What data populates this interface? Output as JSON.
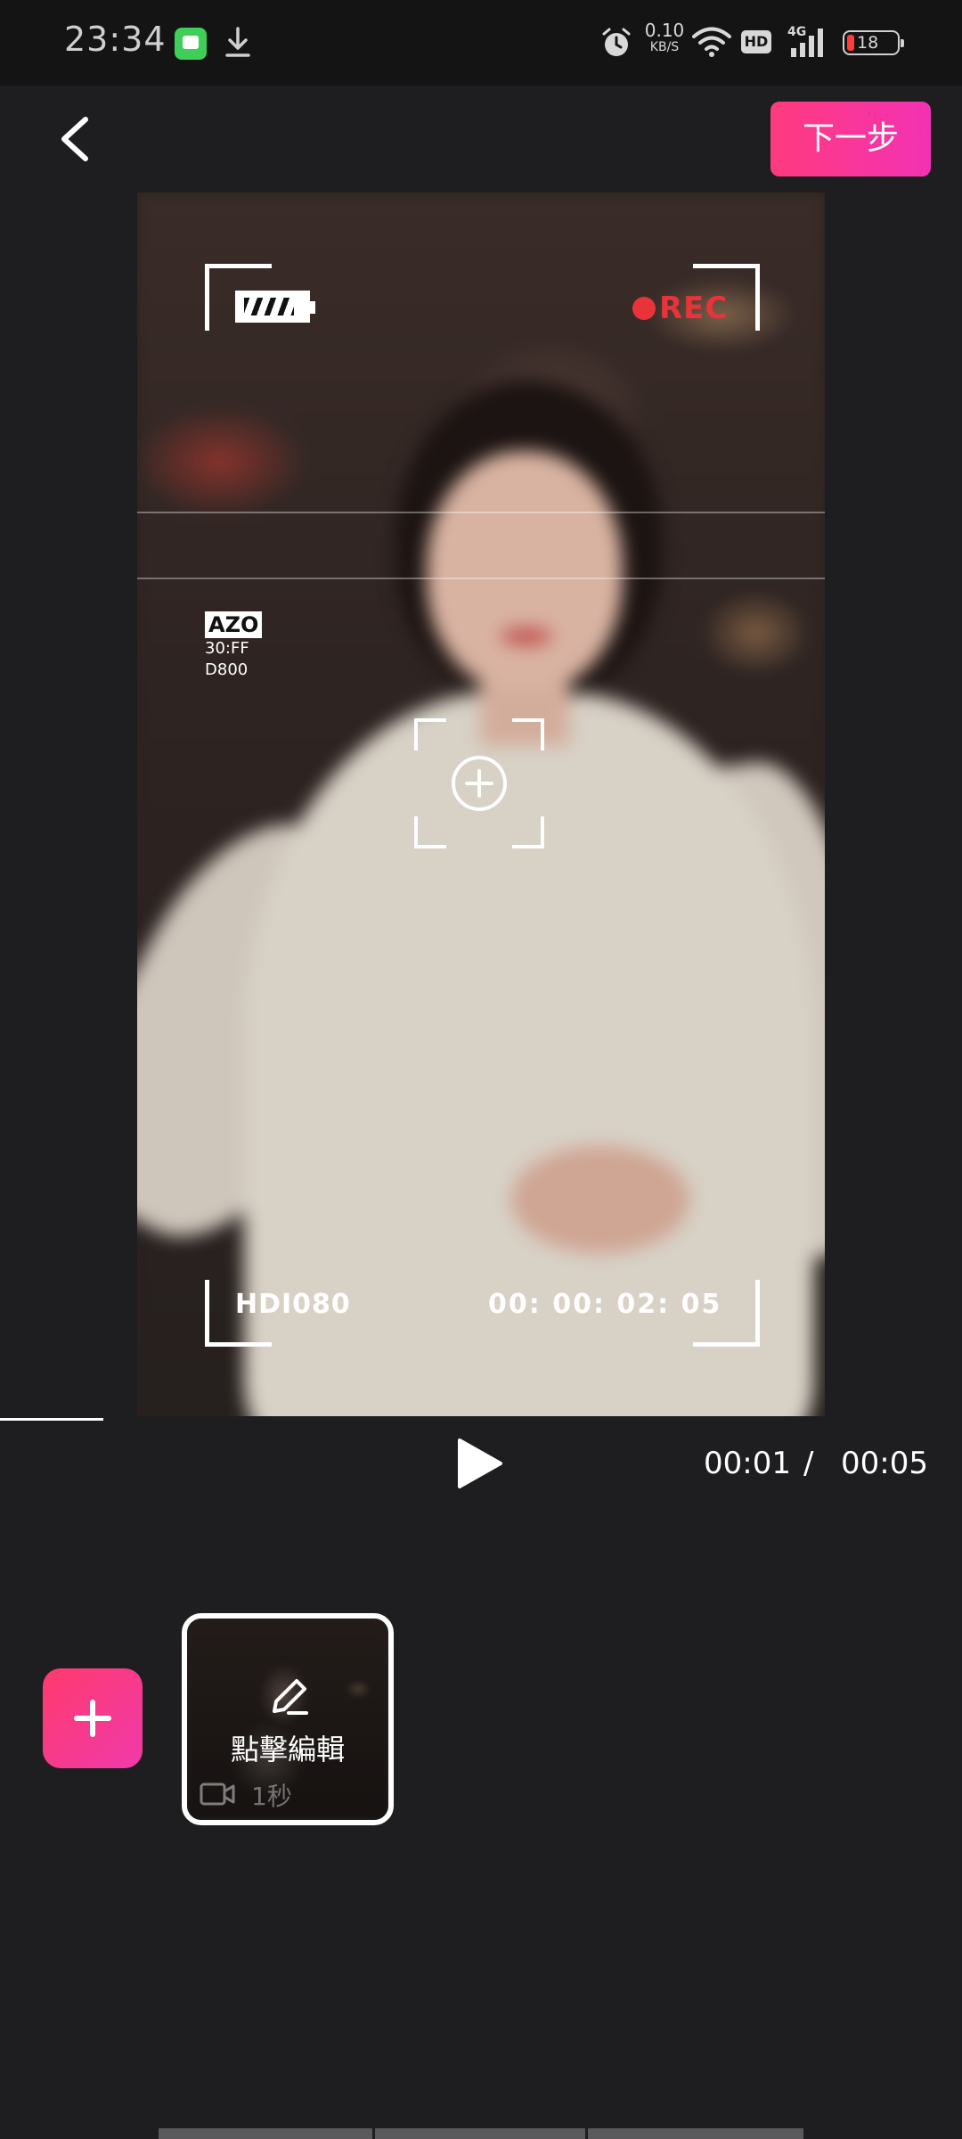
{
  "status_bar": {
    "time": "23:34",
    "net_speed_value": "0.10",
    "net_speed_unit": "KB/S",
    "hd_label": "HD",
    "network_label": "4G",
    "battery_level": "18",
    "icons": [
      "message-app-icon",
      "download-icon",
      "alarm-icon",
      "wifi-icon",
      "signal-icon",
      "battery-icon"
    ]
  },
  "header": {
    "back_icon": "chevron-left-icon",
    "next_label": "下一步",
    "next_color": "#ff3a8c"
  },
  "preview": {
    "battery_icon": "viewfinder-battery-icon",
    "rec_label": "REC",
    "rec_color": "#e8333a",
    "badge_text": "AZO",
    "badge_line1": "30:FF",
    "badge_line2": "D800",
    "focus_icon": "focus-plus-icon",
    "resolution": "HDI080",
    "timecode": "00: 00: 02: 05"
  },
  "playback": {
    "progress": 0.107,
    "current_time": "00:01",
    "separator": "/",
    "total_time": "00:05"
  },
  "timeline": {
    "add_icon": "plus-icon",
    "clip": {
      "label": "點擊編輯",
      "duration": "1秒",
      "edit_icon": "pencil-icon",
      "type_icon": "video-camera-icon"
    }
  }
}
